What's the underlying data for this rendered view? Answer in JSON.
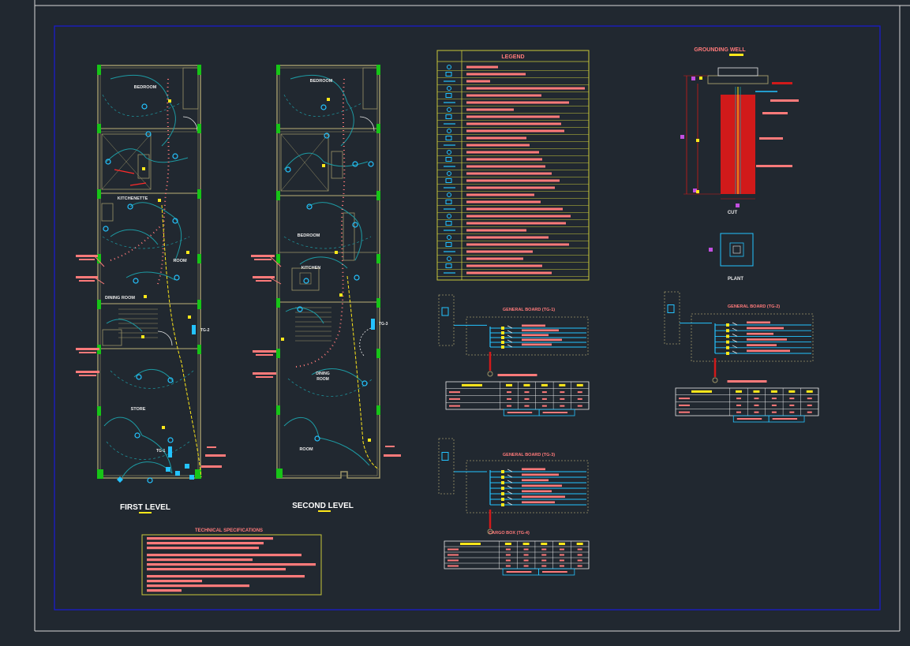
{
  "colors": {
    "background": "#212830",
    "sheet_border": "#d9d9d9",
    "frame": "#1a1ad6",
    "walls": "#9c9468",
    "circuits": "#1d9aa3",
    "fixtures": "#24c3ff",
    "annotations": "#ff7a7a",
    "feeder": "#ffe81a",
    "switches": "#e8e8e8",
    "grounding_fill": "#d11a1a",
    "box": "#c9c93a"
  },
  "plans": {
    "first_level": {
      "title": "FIRST LEVEL",
      "rooms": {
        "bedroom": "BEDROOM",
        "kitchenette": "KITCHENETTE",
        "room": "ROOM",
        "dining_room": "DINING ROOM",
        "store": "STORE"
      },
      "boards": {
        "tg2": "TG-2",
        "tg1": "TG-1"
      }
    },
    "second_level": {
      "title": "SECOND LEVEL",
      "rooms": {
        "bedroom_top": "BEDROOM",
        "bedroom_mid": "BEDROOM",
        "kitchen": "KITCHEN",
        "dining_room_1": "DINING",
        "dining_room_2": "ROOM",
        "room": "ROOM"
      },
      "boards": {
        "tg3": "TG-3"
      }
    }
  },
  "legend": {
    "title": "LEGEND",
    "row_count": 30
  },
  "grounding_well": {
    "title": "GROUNDING WELL",
    "cut_label": "CUT",
    "plant_label": "PLANT"
  },
  "boards": {
    "tg1": {
      "title": "GENERAL BOARD  (TG-1)"
    },
    "tg2": {
      "title": "GENERAL BOARD  (TG-2)"
    },
    "tg3": {
      "title": "GENERAL BOARD  (TG-3)"
    },
    "cargo": {
      "title": "CARGO BOX (TG-4)"
    }
  },
  "technical_specifications": {
    "title": "TECHNICAL SPECIFICATIONS"
  }
}
